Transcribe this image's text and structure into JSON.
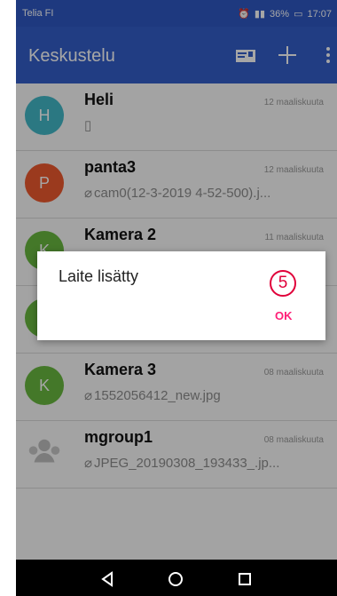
{
  "status": {
    "carrier": "Telia FI",
    "battery": "36%",
    "time": "17:07"
  },
  "appbar": {
    "title": "Keskustelu"
  },
  "conversations": [
    {
      "initial": "H",
      "name": "Heli",
      "time": "12 maaliskuuta",
      "preview": "▯",
      "color": "#42b8c8"
    },
    {
      "initial": "P",
      "name": "panta3",
      "time": "12 maaliskuuta",
      "preview": "cam0(12-3-2019 4-52-500).j...",
      "color": "#ef5a2f"
    },
    {
      "initial": "K",
      "name": "Kamera 2",
      "time": "11 maaliskuuta",
      "preview": "",
      "color": "#69b93f"
    },
    {
      "initial": "K",
      "name": "",
      "time": "",
      "preview": "",
      "color": "#69b93f"
    },
    {
      "initial": "K",
      "name": "Kamera 3",
      "time": "08 maaliskuuta",
      "preview": "1552056412_new.jpg",
      "color": "#69b93f"
    },
    {
      "initial": "",
      "name": "mgroup1",
      "time": "08 maaliskuuta",
      "preview": "JPEG_20190308_193433_.jp...",
      "color": ""
    }
  ],
  "dialog": {
    "message": "Laite lisätty",
    "button": "OK",
    "step": "5"
  }
}
